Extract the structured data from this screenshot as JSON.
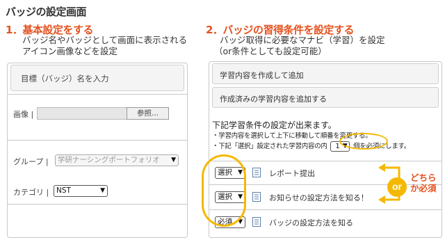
{
  "page": {
    "title": "バッジの設定画面"
  },
  "section1": {
    "heading": "1．基本設定をする",
    "desc_line1": "バッジ名やバッジとして画面に表示される",
    "desc_line2": "アイコン画像などを設定",
    "form": {
      "name_placeholder": "目標（バッジ）名を入力",
      "image_label": "画像 |",
      "browse_button": "参照...",
      "group_label": "グループ |",
      "group_value": "学研ナーシングポートフォリオ",
      "category_label": "カテゴリ |",
      "category_value": "NST"
    }
  },
  "section2": {
    "heading": "2．バッジの習得条件を設定する",
    "desc_line1": "バッジ取得に必要なマナビ（学習）を設定",
    "desc_line2": "（or条件としても設定可能）",
    "panel": {
      "add_new_content": "学習内容を作成して追加",
      "add_existing_content": "作成済みの学習内容を追加する",
      "condition_heading": "下記学習条件の設定が出来ます。",
      "condition_note1": "・学習内容を選択して上下に移動して順番を変更する。",
      "condition_note2_prefix": "・下記「選択」設定された学習内容の内",
      "condition_note2_value": "1",
      "condition_note2_suffix": "個を必須にします。",
      "items": [
        {
          "select_value": "選択",
          "label": "レポート提出"
        },
        {
          "select_value": "選択",
          "label": "お知らせの設定方法を知る！"
        },
        {
          "select_value": "必須",
          "label": "バッジの設定方法を知る"
        }
      ]
    },
    "annotation": {
      "or_label": "or",
      "note_line1": "どちら",
      "note_line2": "か必須"
    }
  },
  "colors": {
    "heading_orange": "#e4521f",
    "highlight_yellow": "#f5b800",
    "panel_border": "#c8c8c8"
  }
}
